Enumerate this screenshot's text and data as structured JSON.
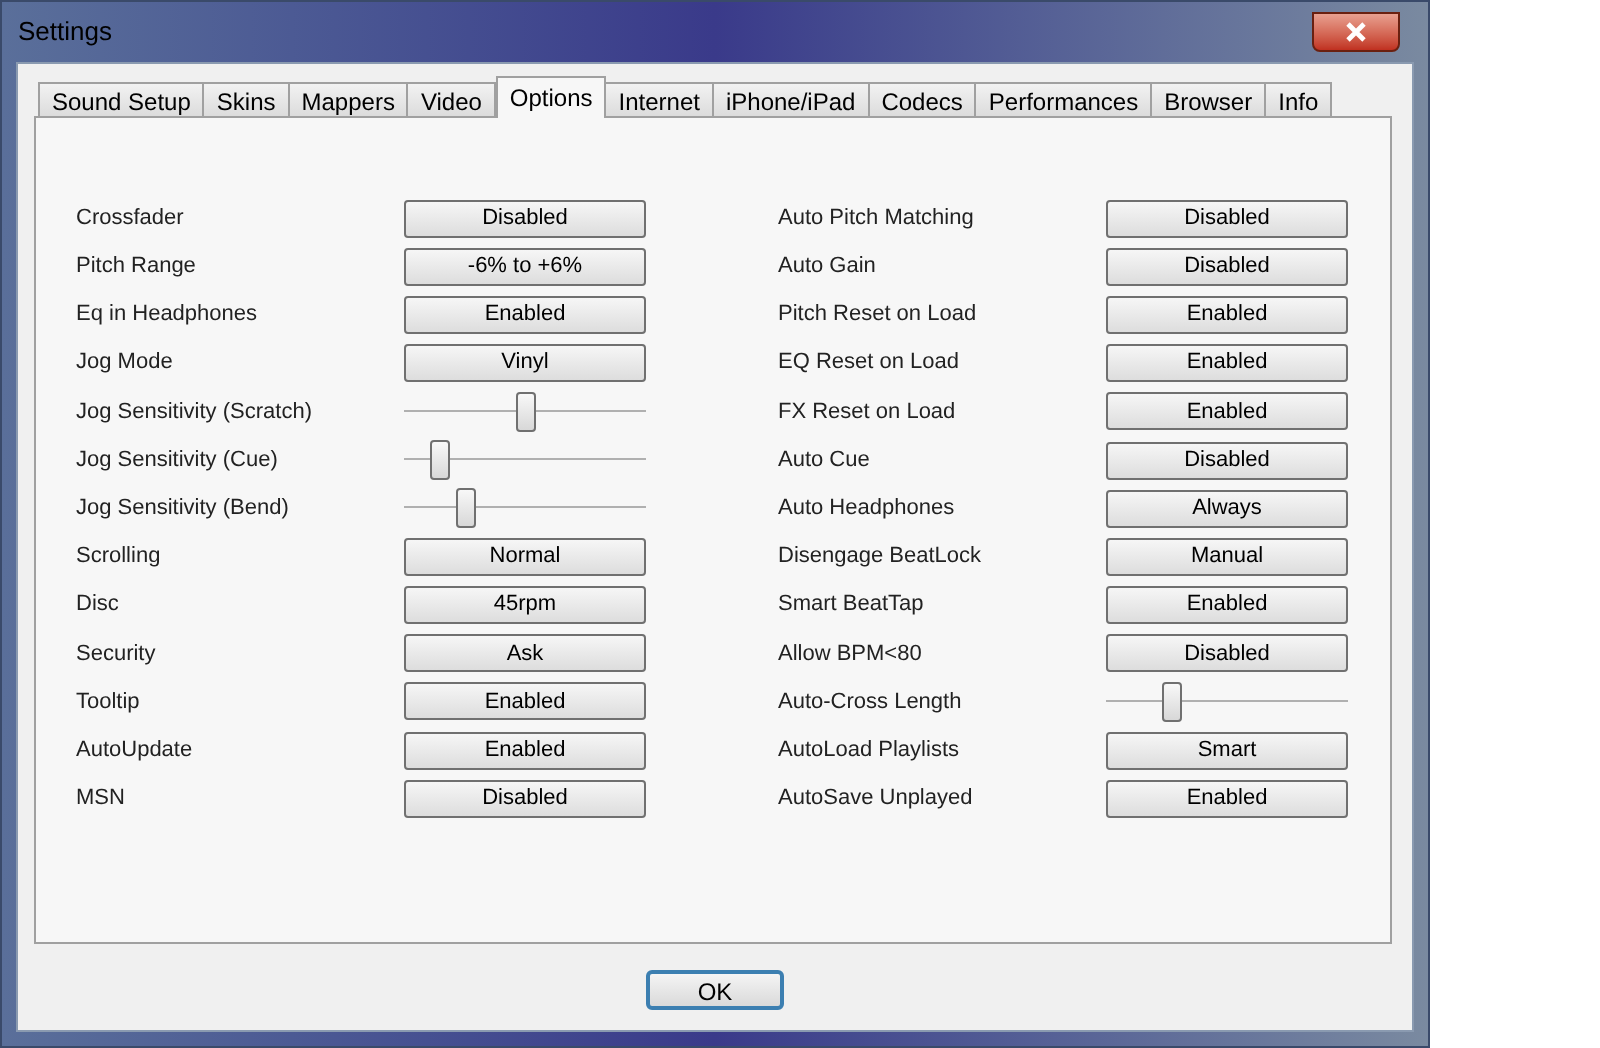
{
  "window": {
    "title": "Settings"
  },
  "tabs": [
    {
      "label": "Sound Setup",
      "selected": false
    },
    {
      "label": "Skins",
      "selected": false
    },
    {
      "label": "Mappers",
      "selected": false
    },
    {
      "label": "Video",
      "selected": false
    },
    {
      "label": "Options",
      "selected": true
    },
    {
      "label": "Internet",
      "selected": false
    },
    {
      "label": "iPhone/iPad",
      "selected": false
    },
    {
      "label": "Codecs",
      "selected": false
    },
    {
      "label": "Performances",
      "selected": false
    },
    {
      "label": "Browser",
      "selected": false
    },
    {
      "label": "Info",
      "selected": false
    }
  ],
  "left_options": [
    {
      "kind": "button",
      "label": "Crossfader",
      "value": "Disabled"
    },
    {
      "kind": "button",
      "label": "Pitch Range",
      "value": "-6% to +6%"
    },
    {
      "kind": "button",
      "label": "Eq in Headphones",
      "value": "Enabled"
    },
    {
      "kind": "button",
      "label": "Jog Mode",
      "value": "Vinyl"
    },
    {
      "kind": "slider",
      "label": "Jog Sensitivity (Scratch)",
      "level": 0.5
    },
    {
      "kind": "slider",
      "label": "Jog Sensitivity (Cue)",
      "level": 0.15
    },
    {
      "kind": "slider",
      "label": "Jog Sensitivity (Bend)",
      "level": 0.26
    },
    {
      "kind": "button",
      "label": "Scrolling",
      "value": "Normal"
    },
    {
      "kind": "button",
      "label": "Disc",
      "value": "45rpm"
    },
    {
      "kind": "button",
      "label": "Security",
      "value": "Ask"
    },
    {
      "kind": "button",
      "label": "Tooltip",
      "value": "Enabled"
    },
    {
      "kind": "button",
      "label": "AutoUpdate",
      "value": "Enabled"
    },
    {
      "kind": "button",
      "label": "MSN",
      "value": "Disabled"
    }
  ],
  "right_options": [
    {
      "kind": "button",
      "label": "Auto Pitch Matching",
      "value": "Disabled"
    },
    {
      "kind": "button",
      "label": "Auto Gain",
      "value": "Disabled"
    },
    {
      "kind": "button",
      "label": "Pitch Reset on Load",
      "value": "Enabled"
    },
    {
      "kind": "button",
      "label": "EQ Reset on Load",
      "value": "Enabled"
    },
    {
      "kind": "button",
      "label": "FX Reset on Load",
      "value": "Enabled"
    },
    {
      "kind": "button",
      "label": "Auto Cue",
      "value": "Disabled"
    },
    {
      "kind": "button",
      "label": "Auto Headphones",
      "value": "Always"
    },
    {
      "kind": "button",
      "label": "Disengage BeatLock",
      "value": "Manual"
    },
    {
      "kind": "button",
      "label": "Smart BeatTap",
      "value": "Enabled"
    },
    {
      "kind": "button",
      "label": "Allow BPM<80",
      "value": "Disabled"
    },
    {
      "kind": "slider",
      "label": "Auto-Cross Length",
      "level": 0.27
    },
    {
      "kind": "button",
      "label": "AutoLoad Playlists",
      "value": "Smart"
    },
    {
      "kind": "button",
      "label": "AutoSave Unplayed",
      "value": "Enabled"
    }
  ],
  "buttons": [
    "OK"
  ]
}
